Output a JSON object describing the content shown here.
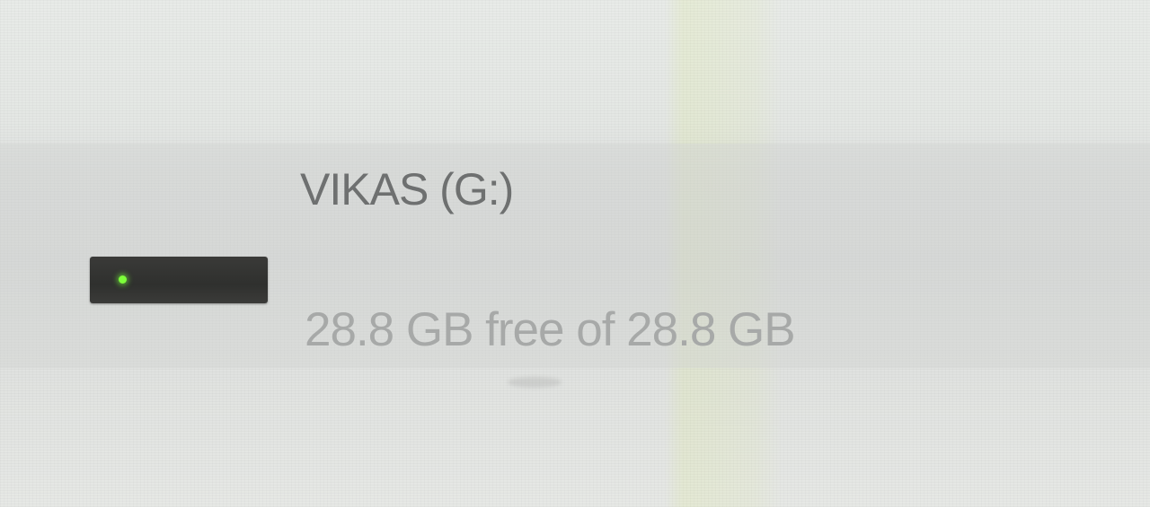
{
  "drive": {
    "name": "VIKAS (G:)",
    "capacity_text": "28.8 GB free of 28.8 GB",
    "used_fraction": 0.0,
    "icon": "usb-drive-icon",
    "led_color": "#7dff3a",
    "bar_color": "#2f302e"
  }
}
